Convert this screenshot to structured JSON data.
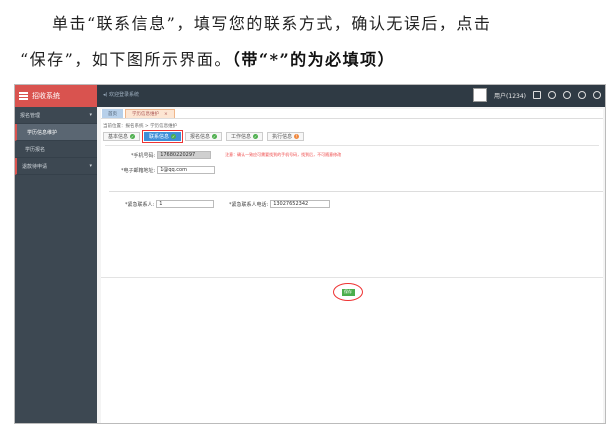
{
  "doc": {
    "line1": "单击“联系信息”，填写您的联系方式，确认无误后，点击",
    "line2_prefix": "“保存”，如下图所示界面。",
    "line2_bold": "（带“*”的为必填项）"
  },
  "app": {
    "brand": "招收系统",
    "back_text": "◂) 欢迎登录系统",
    "user_label": "用户(1234)"
  },
  "sidebar": {
    "items": [
      {
        "label": "报名管理",
        "arrow": "▾"
      },
      {
        "label": "学历信息维护"
      },
      {
        "label": "学历报名"
      },
      {
        "label": "退款待申请",
        "arrow": "▾"
      }
    ]
  },
  "tabs": {
    "home": "首页",
    "current": "学历信息维护",
    "close": "×"
  },
  "breadcrumb": "当前位置：报名系统 > 学历信息维护",
  "steps": [
    {
      "label": "基本信息",
      "state": "ok"
    },
    {
      "label": "联系信息",
      "state": "ok"
    },
    {
      "label": "报名信息",
      "state": "ok"
    },
    {
      "label": "工作信息",
      "state": "ok"
    },
    {
      "label": "执行信息",
      "state": "warn"
    }
  ],
  "form": {
    "phone_label": "*手机号码:",
    "phone_value": "17680220297",
    "phone_hint": "注意：确认一致应可需要找到的手机号码，找到后，不可随意修改",
    "email_label": "*电子邮箱地址:",
    "email_value": "1@qq.com",
    "contact_label": "*紧急联系人:",
    "contact_value": "1",
    "contact_phone_label": "*紧急联系人电话:",
    "contact_phone_value": "13027652342"
  },
  "save_label": "保存"
}
